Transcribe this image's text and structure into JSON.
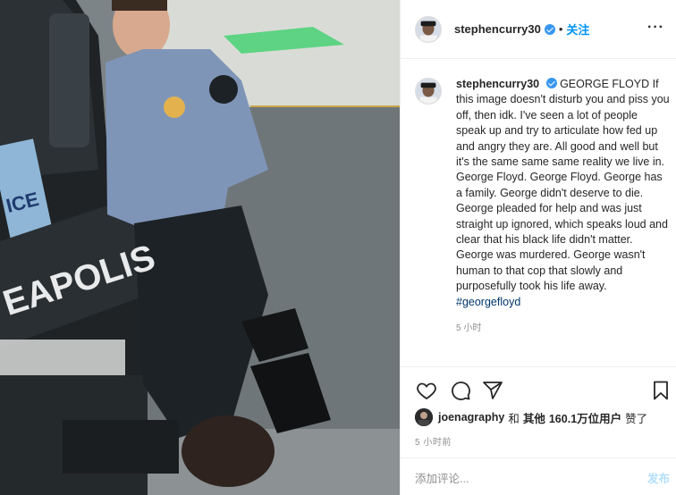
{
  "photo": {
    "vehicle_text": "EAPOLIS",
    "plate_text": "ICE",
    "badge_text": "POLICE"
  },
  "post": {
    "username": "stephencurry30",
    "follow_label": "关注",
    "caption_title": "GEORGE FLOYD",
    "caption_body": "If this image doesn't disturb you and piss you off, then idk. I've seen a lot of people speak up and try to articulate how fed up and angry they are. All good and well but it's the same same same reality we live in. George Floyd. George Floyd. George has a family. George didn't deserve to die. George pleaded for help and was just straight up ignored, which speaks loud and clear that his black life didn't matter. George was murdered. George wasn't human to that cop that slowly and purposefully took his life away.",
    "hashtag": "#georgefloyd",
    "caption_time": "5 小时",
    "likes": {
      "user": "joenagraphy",
      "and": "和",
      "others": "其他",
      "count": "160.1万",
      "suffix": "位用户",
      "liked": "赞了"
    },
    "post_time": "5 小时前",
    "comment_placeholder": "添加评论...",
    "post_label": "发布"
  },
  "colors": {
    "accent": "#0095f6",
    "verified": "#3897f0",
    "muted": "#8e8e8e"
  }
}
